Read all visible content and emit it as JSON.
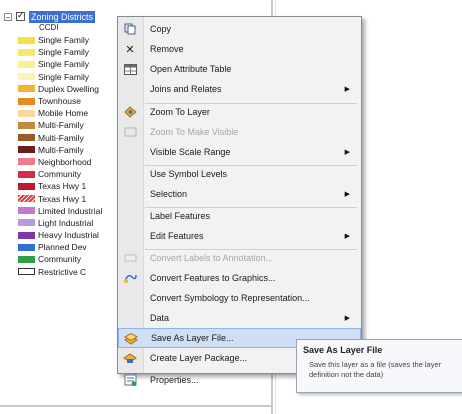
{
  "toc": {
    "layer_name": "Zoning Districts",
    "field_name": "CCDI",
    "legend": [
      {
        "label": "Single Family",
        "color": "#f4e04d"
      },
      {
        "label": "Single Family",
        "color": "#f7e96f"
      },
      {
        "label": "Single Family",
        "color": "#f9ef95"
      },
      {
        "label": "Single Family",
        "color": "#fbf4b6"
      },
      {
        "label": "Duplex Dwelling",
        "color": "#f2b233"
      },
      {
        "label": "Townhouse",
        "color": "#e68a24"
      },
      {
        "label": "Mobile Home",
        "color": "#f6d9a0"
      },
      {
        "label": "Multi-Family",
        "color": "#c48a3a"
      },
      {
        "label": "Multi-Family",
        "color": "#9c5a2a"
      },
      {
        "label": "Multi-Family",
        "color": "#6b1f1a"
      },
      {
        "label": "Neighborhood",
        "color": "#f07b8a"
      },
      {
        "label": "Community",
        "color": "#d62b4b"
      },
      {
        "label": "Texas Hwy 1",
        "color": "#c01a2a"
      },
      {
        "label": "Texas Hwy 1",
        "color": "#e23a3a",
        "hatched": true
      },
      {
        "label": "Limited Industrial",
        "color": "#c47ac8"
      },
      {
        "label": "Light Industrial",
        "color": "#b79be0"
      },
      {
        "label": "Heavy Industrial",
        "color": "#7a3aa6"
      },
      {
        "label": "Planned Dev",
        "color": "#2f6fd0"
      },
      {
        "label": "Community",
        "color": "#2fa04a"
      },
      {
        "label": "Restrictive C",
        "color": "#ffffff",
        "outline": true
      }
    ]
  },
  "menu": {
    "items": [
      {
        "label": "Copy",
        "icon": "copy-icon"
      },
      {
        "label": "Remove",
        "icon": "remove-icon"
      },
      {
        "label": "Open Attribute Table",
        "icon": "table-icon"
      },
      {
        "label": "Joins and Relates",
        "submenu": true
      },
      {
        "label": "Zoom To Layer",
        "icon": "zoom-to-layer-icon"
      },
      {
        "label": "Zoom To Make Visible",
        "icon": "zoom-visible-icon",
        "disabled": true
      },
      {
        "label": "Visible Scale Range",
        "submenu": true
      },
      {
        "label": "Use Symbol Levels"
      },
      {
        "label": "Selection",
        "submenu": true
      },
      {
        "label": "Label Features"
      },
      {
        "label": "Edit Features",
        "submenu": true
      },
      {
        "label": "Convert Labels to Annotation...",
        "icon": "convert-labels-icon",
        "disabled": true
      },
      {
        "label": "Convert Features to Graphics...",
        "icon": "convert-graphics-icon"
      },
      {
        "label": "Convert Symbology to Representation..."
      },
      {
        "label": "Data",
        "submenu": true
      },
      {
        "label": "Save As Layer File...",
        "icon": "save-layer-icon",
        "highlighted": true
      },
      {
        "label": "Create Layer Package...",
        "icon": "layer-package-icon"
      },
      {
        "label": "Properties...",
        "icon": "properties-icon"
      }
    ]
  },
  "tooltip": {
    "title": "Save As Layer File",
    "description": "Save this layer as a file (saves the layer definition not the data)"
  }
}
